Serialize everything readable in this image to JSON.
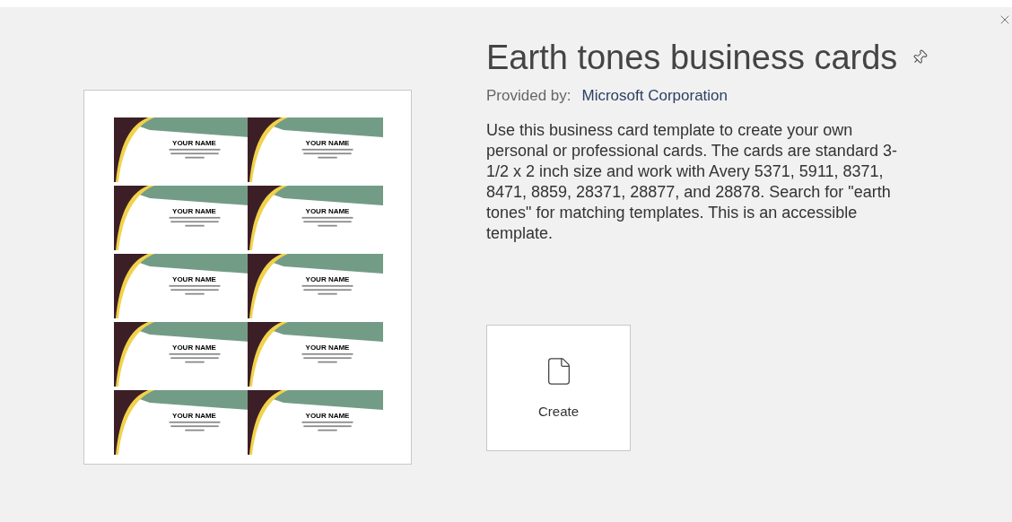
{
  "preview": {
    "cards": [
      {
        "name": "YOUR NAME"
      },
      {
        "name": "YOUR NAME"
      },
      {
        "name": "YOUR NAME"
      },
      {
        "name": "YOUR NAME"
      },
      {
        "name": "YOUR NAME"
      },
      {
        "name": "YOUR NAME"
      },
      {
        "name": "YOUR NAME"
      },
      {
        "name": "YOUR NAME"
      },
      {
        "name": "YOUR NAME"
      },
      {
        "name": "YOUR NAME"
      }
    ]
  },
  "title": "Earth tones business cards",
  "provider": {
    "label": "Provided by:",
    "name": "Microsoft Corporation"
  },
  "description": "Use this business card template to create your own personal or professional cards. The cards are standard 3-1/2 x 2 inch size and work with Avery 5371, 5911, 8371, 8471, 8859, 28371, 28877, and 28878. Search for \"earth tones\" for matching templates. This is an accessible template.",
  "create_button": {
    "label": "Create"
  }
}
